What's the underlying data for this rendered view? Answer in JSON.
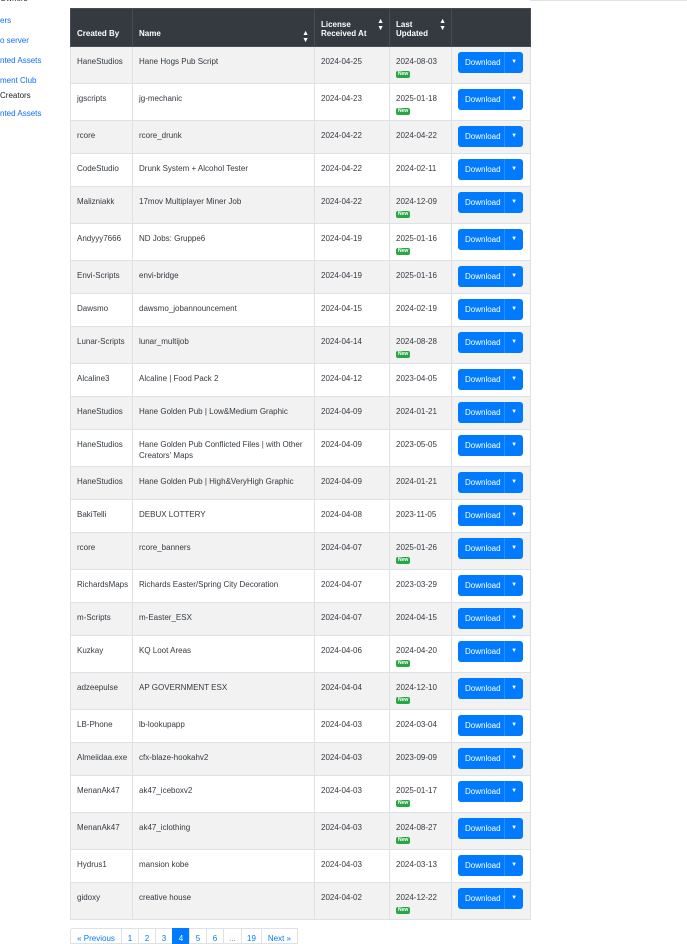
{
  "sidebar": {
    "items": [
      {
        "label": "Owners",
        "kind": "text"
      },
      {
        "label": "ers",
        "kind": "link"
      },
      {
        "label": "o server",
        "kind": "link"
      },
      {
        "label": "nted Assets",
        "kind": "link"
      },
      {
        "label": "ment Club",
        "kind": "link"
      },
      {
        "label": "Creators",
        "kind": "text"
      },
      {
        "label": "nted Assets",
        "kind": "link"
      }
    ]
  },
  "table": {
    "headers": {
      "created_by": "Created By",
      "name": "Name",
      "license_line1": "License",
      "license_line2": "Received At",
      "updated_line1": "Last",
      "updated_line2": "Updated"
    },
    "sort_icon": "sort-icon",
    "download_label": "Download",
    "new_badge": "New",
    "rows": [
      {
        "creator": "HaneStudios",
        "name": "Hane Hogs Pub Script",
        "received": "2024-04-25",
        "updated": "2024-08-03",
        "new": true
      },
      {
        "creator": "jgscripts",
        "name": "jg-mechanic",
        "received": "2024-04-23",
        "updated": "2025-01-18",
        "new": true
      },
      {
        "creator": "rcore",
        "name": "rcore_drunk",
        "received": "2024-04-22",
        "updated": "2024-04-22",
        "new": false
      },
      {
        "creator": "CodeStudio",
        "name": "Drunk System + Alcohol Tester",
        "received": "2024-04-22",
        "updated": "2024-02-11",
        "new": false
      },
      {
        "creator": "Malizniakk",
        "name": "17mov Multiplayer Miner Job",
        "received": "2024-04-22",
        "updated": "2024-12-09",
        "new": true
      },
      {
        "creator": "Andyyy7666",
        "name": "ND Jobs: Gruppe6",
        "received": "2024-04-19",
        "updated": "2025-01-16",
        "new": true
      },
      {
        "creator": "Envi-Scripts",
        "name": "envi-bridge",
        "received": "2024-04-19",
        "updated": "2025-01-16",
        "new": false
      },
      {
        "creator": "Dawsmo",
        "name": "dawsmo_jobannouncement",
        "received": "2024-04-15",
        "updated": "2024-02-19",
        "new": false
      },
      {
        "creator": "Lunar-Scripts",
        "name": "lunar_multijob",
        "received": "2024-04-14",
        "updated": "2024-08-28",
        "new": true
      },
      {
        "creator": "Alcaline3",
        "name": "Alcaline | Food Pack 2",
        "received": "2024-04-12",
        "updated": "2023-04-05",
        "new": false
      },
      {
        "creator": "HaneStudios",
        "name": "Hane Golden Pub | Low&Medium Graphic",
        "received": "2024-04-09",
        "updated": "2024-01-21",
        "new": false
      },
      {
        "creator": "HaneStudios",
        "name": "Hane Golden Pub Conflicted Files | with Other Creators' Maps",
        "received": "2024-04-09",
        "updated": "2023-05-05",
        "new": false
      },
      {
        "creator": "HaneStudios",
        "name": "Hane Golden Pub | High&VeryHigh Graphic",
        "received": "2024-04-09",
        "updated": "2024-01-21",
        "new": false
      },
      {
        "creator": "BakiTelli",
        "name": "DEBUX LOTTERY",
        "received": "2024-04-08",
        "updated": "2023-11-05",
        "new": false
      },
      {
        "creator": "rcore",
        "name": "rcore_banners",
        "received": "2024-04-07",
        "updated": "2025-01-26",
        "new": true
      },
      {
        "creator": "RichardsMaps",
        "name": "Richards Easter/Spring City Decoration",
        "received": "2024-04-07",
        "updated": "2023-03-29",
        "new": false
      },
      {
        "creator": "m-Scripts",
        "name": "m-Easter_ESX",
        "received": "2024-04-07",
        "updated": "2024-04-15",
        "new": false
      },
      {
        "creator": "Kuzkay",
        "name": "KQ Loot Areas",
        "received": "2024-04-06",
        "updated": "2024-04-20",
        "new": true
      },
      {
        "creator": "adzeepulse",
        "name": "AP GOVERNMENT ESX",
        "received": "2024-04-04",
        "updated": "2024-12-10",
        "new": true
      },
      {
        "creator": "LB-Phone",
        "name": "lb-lookupapp",
        "received": "2024-04-03",
        "updated": "2024-03-04",
        "new": false
      },
      {
        "creator": "Almeiidaa.exe",
        "name": "cfx-blaze-hookahv2",
        "received": "2024-04-03",
        "updated": "2023-09-09",
        "new": false
      },
      {
        "creator": "MenanAk47",
        "name": "ak47_iceboxv2",
        "received": "2024-04-03",
        "updated": "2025-01-17",
        "new": true
      },
      {
        "creator": "MenanAk47",
        "name": "ak47_iclothing",
        "received": "2024-04-03",
        "updated": "2024-08-27",
        "new": true
      },
      {
        "creator": "Hydrus1",
        "name": "mansion kobe",
        "received": "2024-04-03",
        "updated": "2024-03-13",
        "new": false
      },
      {
        "creator": "gidoxy",
        "name": "creative house",
        "received": "2024-04-02",
        "updated": "2024-12-22",
        "new": true
      }
    ]
  },
  "pagination": {
    "items": [
      {
        "label": "« Previous",
        "kind": "prev"
      },
      {
        "label": "1",
        "kind": "page"
      },
      {
        "label": "2",
        "kind": "page"
      },
      {
        "label": "3",
        "kind": "page"
      },
      {
        "label": "4",
        "kind": "active"
      },
      {
        "label": "5",
        "kind": "page"
      },
      {
        "label": "6",
        "kind": "page"
      },
      {
        "label": "...",
        "kind": "dots"
      },
      {
        "label": "19",
        "kind": "page"
      },
      {
        "label": "Next »",
        "kind": "next"
      }
    ]
  },
  "colors": {
    "header_bg": "#343a40",
    "primary": "#007bff",
    "badge": "#28a745",
    "stripe": "#f2f2f2"
  }
}
